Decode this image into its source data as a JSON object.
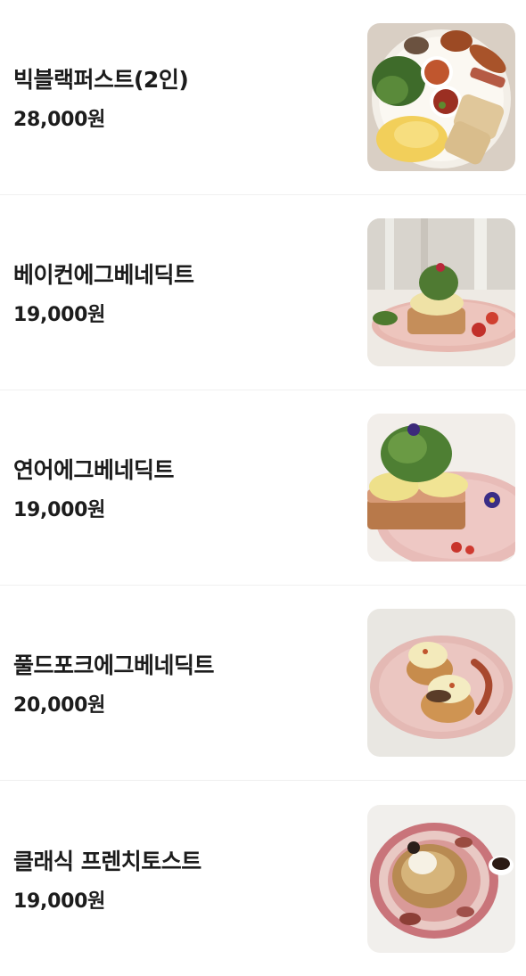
{
  "menu": {
    "items": [
      {
        "name": "빅블랙퍼스트(2인)",
        "price": "28,000원",
        "photo": "big-breakfast-photo"
      },
      {
        "name": "베이컨에그베네딕트",
        "price": "19,000원",
        "photo": "bacon-eggs-benedict-photo"
      },
      {
        "name": "연어에그베네딕트",
        "price": "19,000원",
        "photo": "salmon-eggs-benedict-photo"
      },
      {
        "name": "풀드포크에그베네딕트",
        "price": "20,000원",
        "photo": "pulled-pork-eggs-benedict-photo"
      },
      {
        "name": "클래식 프렌치토스트",
        "price": "19,000원",
        "photo": "classic-french-toast-photo"
      }
    ]
  }
}
